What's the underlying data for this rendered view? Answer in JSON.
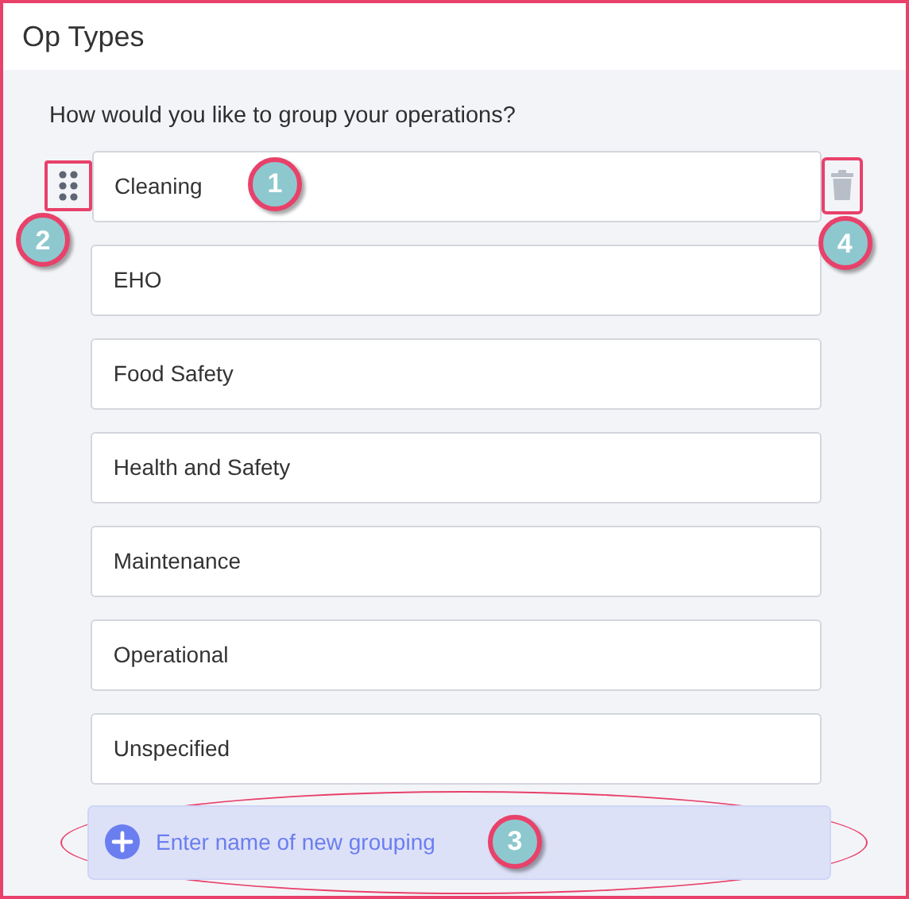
{
  "header": {
    "title": "Op Types"
  },
  "prompt": "How would you like to group your operations?",
  "groupings": [
    {
      "name": "Cleaning",
      "callout": "1",
      "highlighted": true
    },
    {
      "name": "EHO",
      "highlighted": false
    },
    {
      "name": "Food Safety",
      "highlighted": false
    },
    {
      "name": "Health and Safety",
      "highlighted": false
    },
    {
      "name": "Maintenance",
      "highlighted": false
    },
    {
      "name": "Operational",
      "highlighted": false
    },
    {
      "name": "Unspecified",
      "highlighted": false
    }
  ],
  "drag_handle_callout": "2",
  "delete_callout": "4",
  "new_grouping": {
    "placeholder": "Enter name of new grouping",
    "callout": "3"
  }
}
